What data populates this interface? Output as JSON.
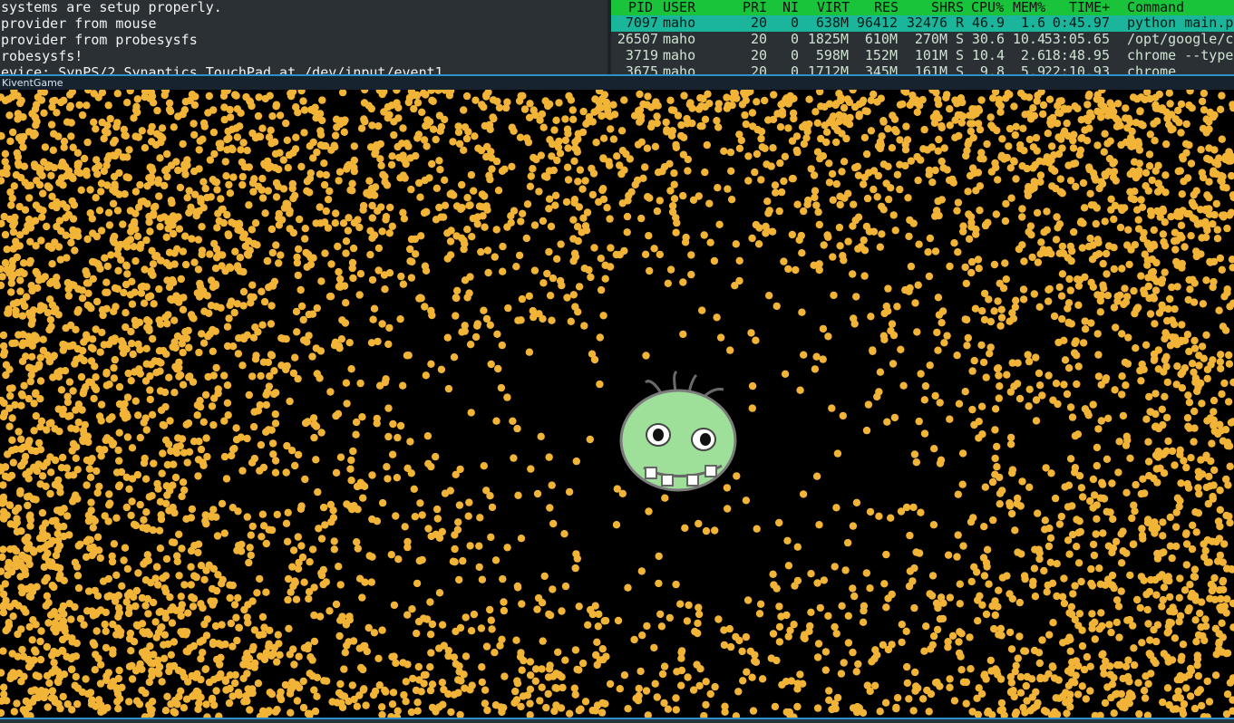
{
  "terminal_left": {
    "lines": [
      "systems are setup properly.",
      "provider from mouse",
      "provider from probesysfs",
      "robesysfs!",
      "evice: SynPS/2 Synaptics TouchPad at /dev/input/event1"
    ]
  },
  "htop": {
    "columns": [
      "PID",
      "USER",
      "PRI",
      "NI",
      "VIRT",
      "RES",
      "SHR",
      "S",
      "CPU%",
      "MEM%",
      "TIME+",
      "Command"
    ],
    "processes": [
      {
        "pid": "7097",
        "user": "maho",
        "pri": "20",
        "ni": "0",
        "virt": "638M",
        "res": "96412",
        "shr": "32476",
        "s": "R",
        "cpu": "46.9",
        "mem": "1.6",
        "time": "0:45.97",
        "command": "python main.p",
        "selected": true
      },
      {
        "pid": "26507",
        "user": "maho",
        "pri": "20",
        "ni": "0",
        "virt": "1825M",
        "res": "610M",
        "shr": "270M",
        "s": "S",
        "cpu": "30.6",
        "mem": "10.4",
        "time": "53:05.65",
        "command": "/opt/google/c"
      },
      {
        "pid": "3719",
        "user": "maho",
        "pri": "20",
        "ni": "0",
        "virt": "598M",
        "res": "152M",
        "shr": "101M",
        "s": "S",
        "cpu": "10.4",
        "mem": "2.6",
        "time": "18:48.95",
        "command": "chrome --type"
      },
      {
        "pid": "3675",
        "user": "maho",
        "pri": "20",
        "ni": "0",
        "virt": "1712M",
        "res": "345M",
        "shr": "161M",
        "s": "S",
        "cpu": "9.8",
        "mem": "5.9",
        "time": "22:10.93",
        "command": "chrome"
      }
    ]
  },
  "game_window": {
    "title": "KiventGame"
  },
  "colors": {
    "terminal_bg": "#2b3035",
    "htop_header": "#19c33a",
    "htop_selected": "#1bb59b",
    "window_accent": "#2e90c9",
    "particle": "#f2b437",
    "character_face": "#9ee09a",
    "canvas_bg": "#000000"
  },
  "icons": {
    "player": "green-monster-face-icon",
    "particle": "yellow-dot"
  }
}
